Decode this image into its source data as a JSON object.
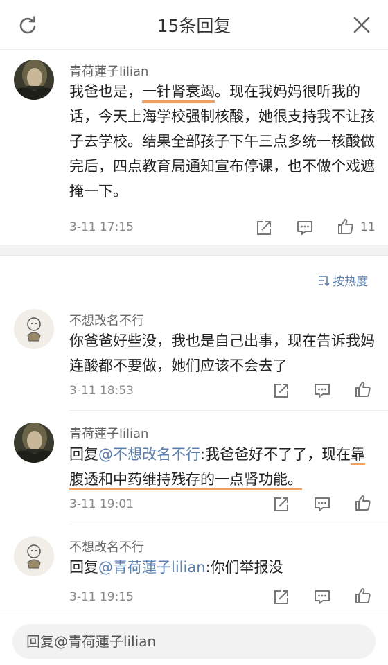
{
  "header": {
    "title": "15条回复"
  },
  "main_comment": {
    "user": "青荷蓮子lilian",
    "segments": [
      {
        "text": "我爸也是，",
        "style": "plain"
      },
      {
        "text": "一针肾衰竭",
        "style": "underline"
      },
      {
        "text": "。现在我妈妈很听我的话，今天上海学校强制核酸，她很支持我不让孩子去学校。结果全部孩子下午三点多统一核酸做完后，四点教育局通知宣布停课，也不做个戏遮掩一下。",
        "style": "plain"
      }
    ],
    "time": "3-11 17:15",
    "likes": "11"
  },
  "sort": {
    "label": "按热度"
  },
  "replies": [
    {
      "user": "不想改名不行",
      "segments": [
        {
          "text": "你爸爸好些没，我也是自己出事，现在告诉我妈连酸都不要做，她们应该不会去了",
          "style": "plain"
        }
      ],
      "time": "3-11 18:53"
    },
    {
      "user": "青荷蓮子lilian",
      "segments": [
        {
          "text": "回复",
          "style": "plain"
        },
        {
          "text": "@不想改名不行",
          "style": "at"
        },
        {
          "text": ":我爸爸好不了了，现在",
          "style": "plain"
        },
        {
          "text": "靠腹透和中药维持残存的一点肾功能。",
          "style": "underline"
        }
      ],
      "time": "3-11 19:01"
    },
    {
      "user": "不想改名不行",
      "segments": [
        {
          "text": "回复",
          "style": "plain"
        },
        {
          "text": "@青荷蓮子lilian",
          "style": "at"
        },
        {
          "text": ":你们举报没",
          "style": "plain"
        }
      ],
      "time": "3-11 19:15"
    }
  ],
  "reply_box": {
    "placeholder": "回复@青荷蓮子lilian"
  },
  "colors": {
    "link": "#5b7fae",
    "underline": "#f0a060",
    "divider": "#f2f2f2"
  },
  "icons": [
    "refresh-icon",
    "close-icon",
    "share-icon",
    "comment-icon",
    "thumbs-up-icon",
    "sort-icon"
  ]
}
